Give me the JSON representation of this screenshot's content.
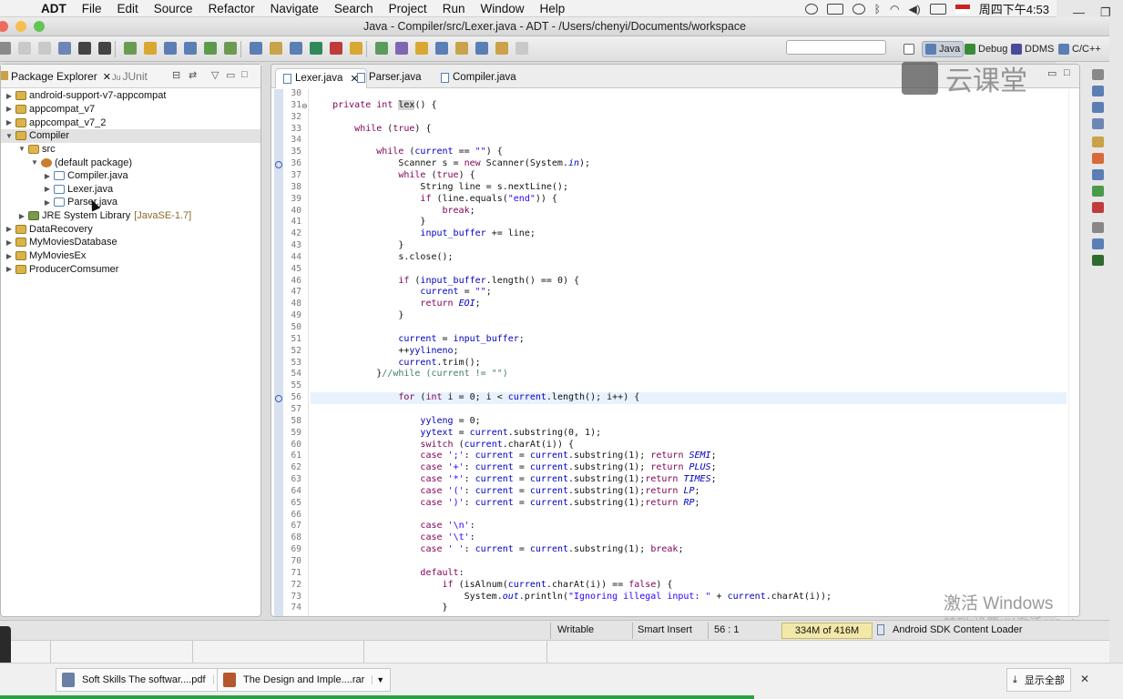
{
  "menubar": {
    "app": "ADT",
    "items": [
      "File",
      "Edit",
      "Source",
      "Refactor",
      "Navigate",
      "Search",
      "Project",
      "Run",
      "Window",
      "Help"
    ],
    "clock": "周四下午4:53"
  },
  "window": {
    "title": "Java - Compiler/src/Lexer.java - ADT - /Users/chenyi/Documents/workspace"
  },
  "perspectives": [
    {
      "label": "Java",
      "active": true
    },
    {
      "label": "Debug",
      "active": false
    },
    {
      "label": "DDMS",
      "active": false
    },
    {
      "label": "C/C++",
      "active": false
    }
  ],
  "explorer": {
    "tabs": [
      {
        "label": "Package Explorer",
        "active": true
      },
      {
        "label": "JUnit",
        "active": false
      }
    ],
    "tree": [
      {
        "label": "android-support-v7-appcompat",
        "depth": 0,
        "twisty": "▶",
        "icon": "folder-project-icon"
      },
      {
        "label": "appcompat_v7",
        "depth": 0,
        "twisty": "▶",
        "icon": "folder-project-icon"
      },
      {
        "label": "appcompat_v7_2",
        "depth": 0,
        "twisty": "▶",
        "icon": "folder-project-icon"
      },
      {
        "label": "Compiler",
        "depth": 0,
        "twisty": "▼",
        "icon": "folder-project-icon",
        "selected": true
      },
      {
        "label": "src",
        "depth": 1,
        "twisty": "▼",
        "icon": "source-folder-icon"
      },
      {
        "label": "(default package)",
        "depth": 2,
        "twisty": "▼",
        "icon": "package-icon"
      },
      {
        "label": "Compiler.java",
        "depth": 3,
        "twisty": "▶",
        "icon": "java-file-icon"
      },
      {
        "label": "Lexer.java",
        "depth": 3,
        "twisty": "▶",
        "icon": "java-file-icon"
      },
      {
        "label": "Parser.java",
        "depth": 3,
        "twisty": "▶",
        "icon": "java-file-icon"
      },
      {
        "label": "JRE System Library",
        "ext": "[JavaSE-1.7]",
        "depth": 1,
        "twisty": "▶",
        "icon": "library-icon"
      },
      {
        "label": "DataRecovery",
        "depth": 0,
        "twisty": "▶",
        "icon": "folder-project-icon"
      },
      {
        "label": "MyMoviesDatabase",
        "depth": 0,
        "twisty": "▶",
        "icon": "folder-project-icon"
      },
      {
        "label": "MyMoviesEx",
        "depth": 0,
        "twisty": "▶",
        "icon": "folder-project-icon"
      },
      {
        "label": "ProducerComsumer",
        "depth": 0,
        "twisty": "▶",
        "icon": "folder-project-icon"
      }
    ]
  },
  "editor": {
    "tabs": [
      {
        "label": "Lexer.java",
        "active": true
      },
      {
        "label": "Parser.java",
        "active": false
      },
      {
        "label": "Compiler.java",
        "active": false
      }
    ],
    "current_line": 56,
    "code": [
      {
        "n": "30",
        "html": ""
      },
      {
        "n": "31",
        "html": "    <span class=\"kw\">private</span> <span class=\"kw\">int</span> <span class=\"lexhl\">lex</span>() {",
        "fold": true
      },
      {
        "n": "32",
        "html": ""
      },
      {
        "n": "33",
        "html": "        <span class=\"kw\">while</span> (<span class=\"kw\">true</span>) {"
      },
      {
        "n": "34",
        "html": ""
      },
      {
        "n": "35",
        "html": "            <span class=\"kw\">while</span> (<span class=\"fld\">current</span> == <span class=\"str\">\"\"</span>) {"
      },
      {
        "n": "36",
        "html": "                Scanner s = <span class=\"kw\">new</span> Scanner(System.<span class=\"fld it\">in</span>);",
        "marker": true
      },
      {
        "n": "37",
        "html": "                <span class=\"kw\">while</span> (<span class=\"kw\">true</span>) {"
      },
      {
        "n": "38",
        "html": "                    String line = s.nextLine();"
      },
      {
        "n": "39",
        "html": "                    <span class=\"kw\">if</span> (line.equals(<span class=\"str\">\"end\"</span>)) {"
      },
      {
        "n": "40",
        "html": "                        <span class=\"kw\">break</span>;"
      },
      {
        "n": "41",
        "html": "                    }"
      },
      {
        "n": "42",
        "html": "                    <span class=\"fld\">input_buffer</span> += line;"
      },
      {
        "n": "43",
        "html": "                }"
      },
      {
        "n": "44",
        "html": "                s.close();"
      },
      {
        "n": "45",
        "html": ""
      },
      {
        "n": "46",
        "html": "                <span class=\"kw\">if</span> (<span class=\"fld\">input_buffer</span>.length() == 0) {"
      },
      {
        "n": "47",
        "html": "                    <span class=\"fld\">current</span> = <span class=\"str\">\"\"</span>;"
      },
      {
        "n": "48",
        "html": "                    <span class=\"kw\">return</span> <span class=\"fld it\">EOI</span>;"
      },
      {
        "n": "49",
        "html": "                }"
      },
      {
        "n": "50",
        "html": ""
      },
      {
        "n": "51",
        "html": "                <span class=\"fld\">current</span> = <span class=\"fld\">input_buffer</span>;"
      },
      {
        "n": "52",
        "html": "                ++<span class=\"fld\">yylineno</span>;"
      },
      {
        "n": "53",
        "html": "                <span class=\"fld\">current</span>.trim();"
      },
      {
        "n": "54",
        "html": "            }<span class=\"cmt\">//while (current != \"\")</span>"
      },
      {
        "n": "55",
        "html": ""
      },
      {
        "n": "56",
        "html": "                <span class=\"kw\">for</span> (<span class=\"kw\">int</span> i = 0; i &lt; <span class=\"fld\">current</span>.length(); i++) {",
        "marker": true
      },
      {
        "n": "57",
        "html": ""
      },
      {
        "n": "58",
        "html": "                    <span class=\"fld\">yyleng</span> = 0;"
      },
      {
        "n": "59",
        "html": "                    <span class=\"fld\">yytext</span> = <span class=\"fld\">current</span>.substring(0, 1);"
      },
      {
        "n": "60",
        "html": "                    <span class=\"kw\">switch</span> (<span class=\"fld\">current</span>.charAt(i)) {"
      },
      {
        "n": "61",
        "html": "                    <span class=\"kw\">case</span> <span class=\"str\">';'</span>: <span class=\"fld\">current</span> = <span class=\"fld\">current</span>.substring(1); <span class=\"kw\">return</span> <span class=\"fld it\">SEMI</span>;"
      },
      {
        "n": "62",
        "html": "                    <span class=\"kw\">case</span> <span class=\"str\">'+'</span>: <span class=\"fld\">current</span> = <span class=\"fld\">current</span>.substring(1); <span class=\"kw\">return</span> <span class=\"fld it\">PLUS</span>;"
      },
      {
        "n": "63",
        "html": "                    <span class=\"kw\">case</span> <span class=\"str\">'*'</span>: <span class=\"fld\">current</span> = <span class=\"fld\">current</span>.substring(1);<span class=\"kw\">return</span> <span class=\"fld it\">TIMES</span>;"
      },
      {
        "n": "64",
        "html": "                    <span class=\"kw\">case</span> <span class=\"str\">'('</span>: <span class=\"fld\">current</span> = <span class=\"fld\">current</span>.substring(1);<span class=\"kw\">return</span> <span class=\"fld it\">LP</span>;"
      },
      {
        "n": "65",
        "html": "                    <span class=\"kw\">case</span> <span class=\"str\">')'</span>: <span class=\"fld\">current</span> = <span class=\"fld\">current</span>.substring(1);<span class=\"kw\">return</span> <span class=\"fld it\">RP</span>;"
      },
      {
        "n": "66",
        "html": ""
      },
      {
        "n": "67",
        "html": "                    <span class=\"kw\">case</span> <span class=\"str\">'\\n'</span>:"
      },
      {
        "n": "68",
        "html": "                    <span class=\"kw\">case</span> <span class=\"str\">'\\t'</span>:"
      },
      {
        "n": "69",
        "html": "                    <span class=\"kw\">case</span> <span class=\"str\">' '</span>: <span class=\"fld\">current</span> = <span class=\"fld\">current</span>.substring(1); <span class=\"kw\">break</span>;"
      },
      {
        "n": "70",
        "html": ""
      },
      {
        "n": "71",
        "html": "                    <span class=\"kw\">default</span>:"
      },
      {
        "n": "72",
        "html": "                        <span class=\"kw\">if</span> (isAlnum(<span class=\"fld\">current</span>.charAt(i)) == <span class=\"kw\">false</span>) {"
      },
      {
        "n": "73",
        "html": "                            System.<span class=\"fld it\">out</span>.println(<span class=\"str\">\"Ignoring illegal input: \"</span> + <span class=\"fld\">current</span>.charAt(i));"
      },
      {
        "n": "74",
        "html": "                        }"
      }
    ]
  },
  "watermark": {
    "text": "云课堂"
  },
  "activation": {
    "line1": "激活 Windows",
    "line2": "转到\"设置\"以激活 Windows。"
  },
  "status": {
    "writable": "Writable",
    "insert_mode": "Smart Insert",
    "position": "56 : 1",
    "heap": "334M of 416M",
    "loader": "Android SDK Content Loader"
  },
  "downloads": [
    {
      "label": "Soft Skills The softwar....pdf",
      "icon_color": "#6a7fa5"
    },
    {
      "label": "The Design and Imple....rar",
      "icon_color": "#b5562c"
    }
  ],
  "download_bar": {
    "show_all": "显示全部"
  },
  "colors": {
    "accent": "#3b5fa8",
    "current_line": "#e8f2fe",
    "heap_bg": "#f2e8a8"
  }
}
